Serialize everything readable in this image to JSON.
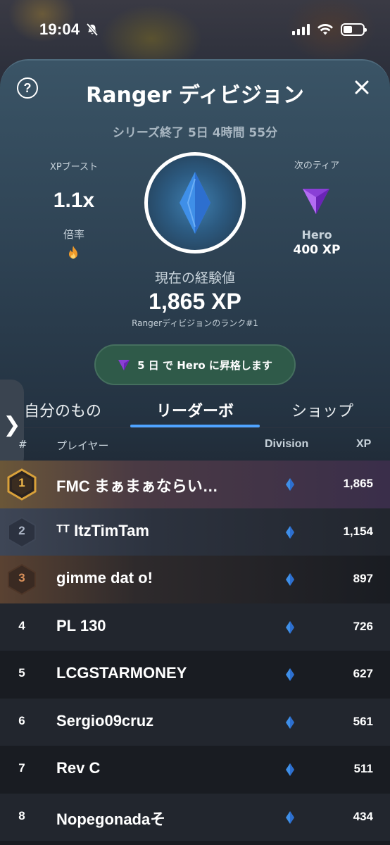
{
  "status_bar": {
    "time": "19:04"
  },
  "header": {
    "title": "Ranger ディビジョン",
    "series_end": "シリーズ終了 5日 4時間 55分",
    "help_icon": "question-circle-icon",
    "close_icon": "close-icon"
  },
  "boost": {
    "label": "XPブースト",
    "value": "1.1x",
    "mult_label": "倍率"
  },
  "next_tier": {
    "label": "次のティア",
    "name": "Hero",
    "xp": "400 XP"
  },
  "current": {
    "label": "現在の経験値",
    "xp": "1,865 XP",
    "rank_text": "Rangerディビジョンのランク#1"
  },
  "promo": {
    "text": "5 日 で Hero に昇格します"
  },
  "tabs": [
    {
      "label": "自分のもの",
      "active": false
    },
    {
      "label": "リーダーボ",
      "active": true
    },
    {
      "label": "ショップ",
      "active": false
    }
  ],
  "table": {
    "headers": {
      "rank": "#",
      "player": "プレイヤー",
      "division": "Division",
      "xp": "XP"
    },
    "rows": [
      {
        "rank": "1",
        "name": "FMC まぁまぁならい…",
        "xp": "1,865"
      },
      {
        "rank": "2",
        "name": "ᵀᵀ ItzTimTam",
        "xp": "1,154"
      },
      {
        "rank": "3",
        "name": "gimme dat o!",
        "xp": "897"
      },
      {
        "rank": "4",
        "name": "PL 130",
        "xp": "726"
      },
      {
        "rank": "5",
        "name": "LCGSTARMONEY",
        "xp": "627"
      },
      {
        "rank": "6",
        "name": "Sergio09cruz",
        "xp": "561"
      },
      {
        "rank": "7",
        "name": "Rev C",
        "xp": "511"
      },
      {
        "rank": "8",
        "name": "Nopegonadaそ",
        "xp": "434"
      }
    ]
  },
  "colors": {
    "accent": "#4fa4ff",
    "promo_bg": "#2f5a49",
    "hero_purple": "#8a3fd6",
    "ranger_blue": "#3f8fe8"
  }
}
